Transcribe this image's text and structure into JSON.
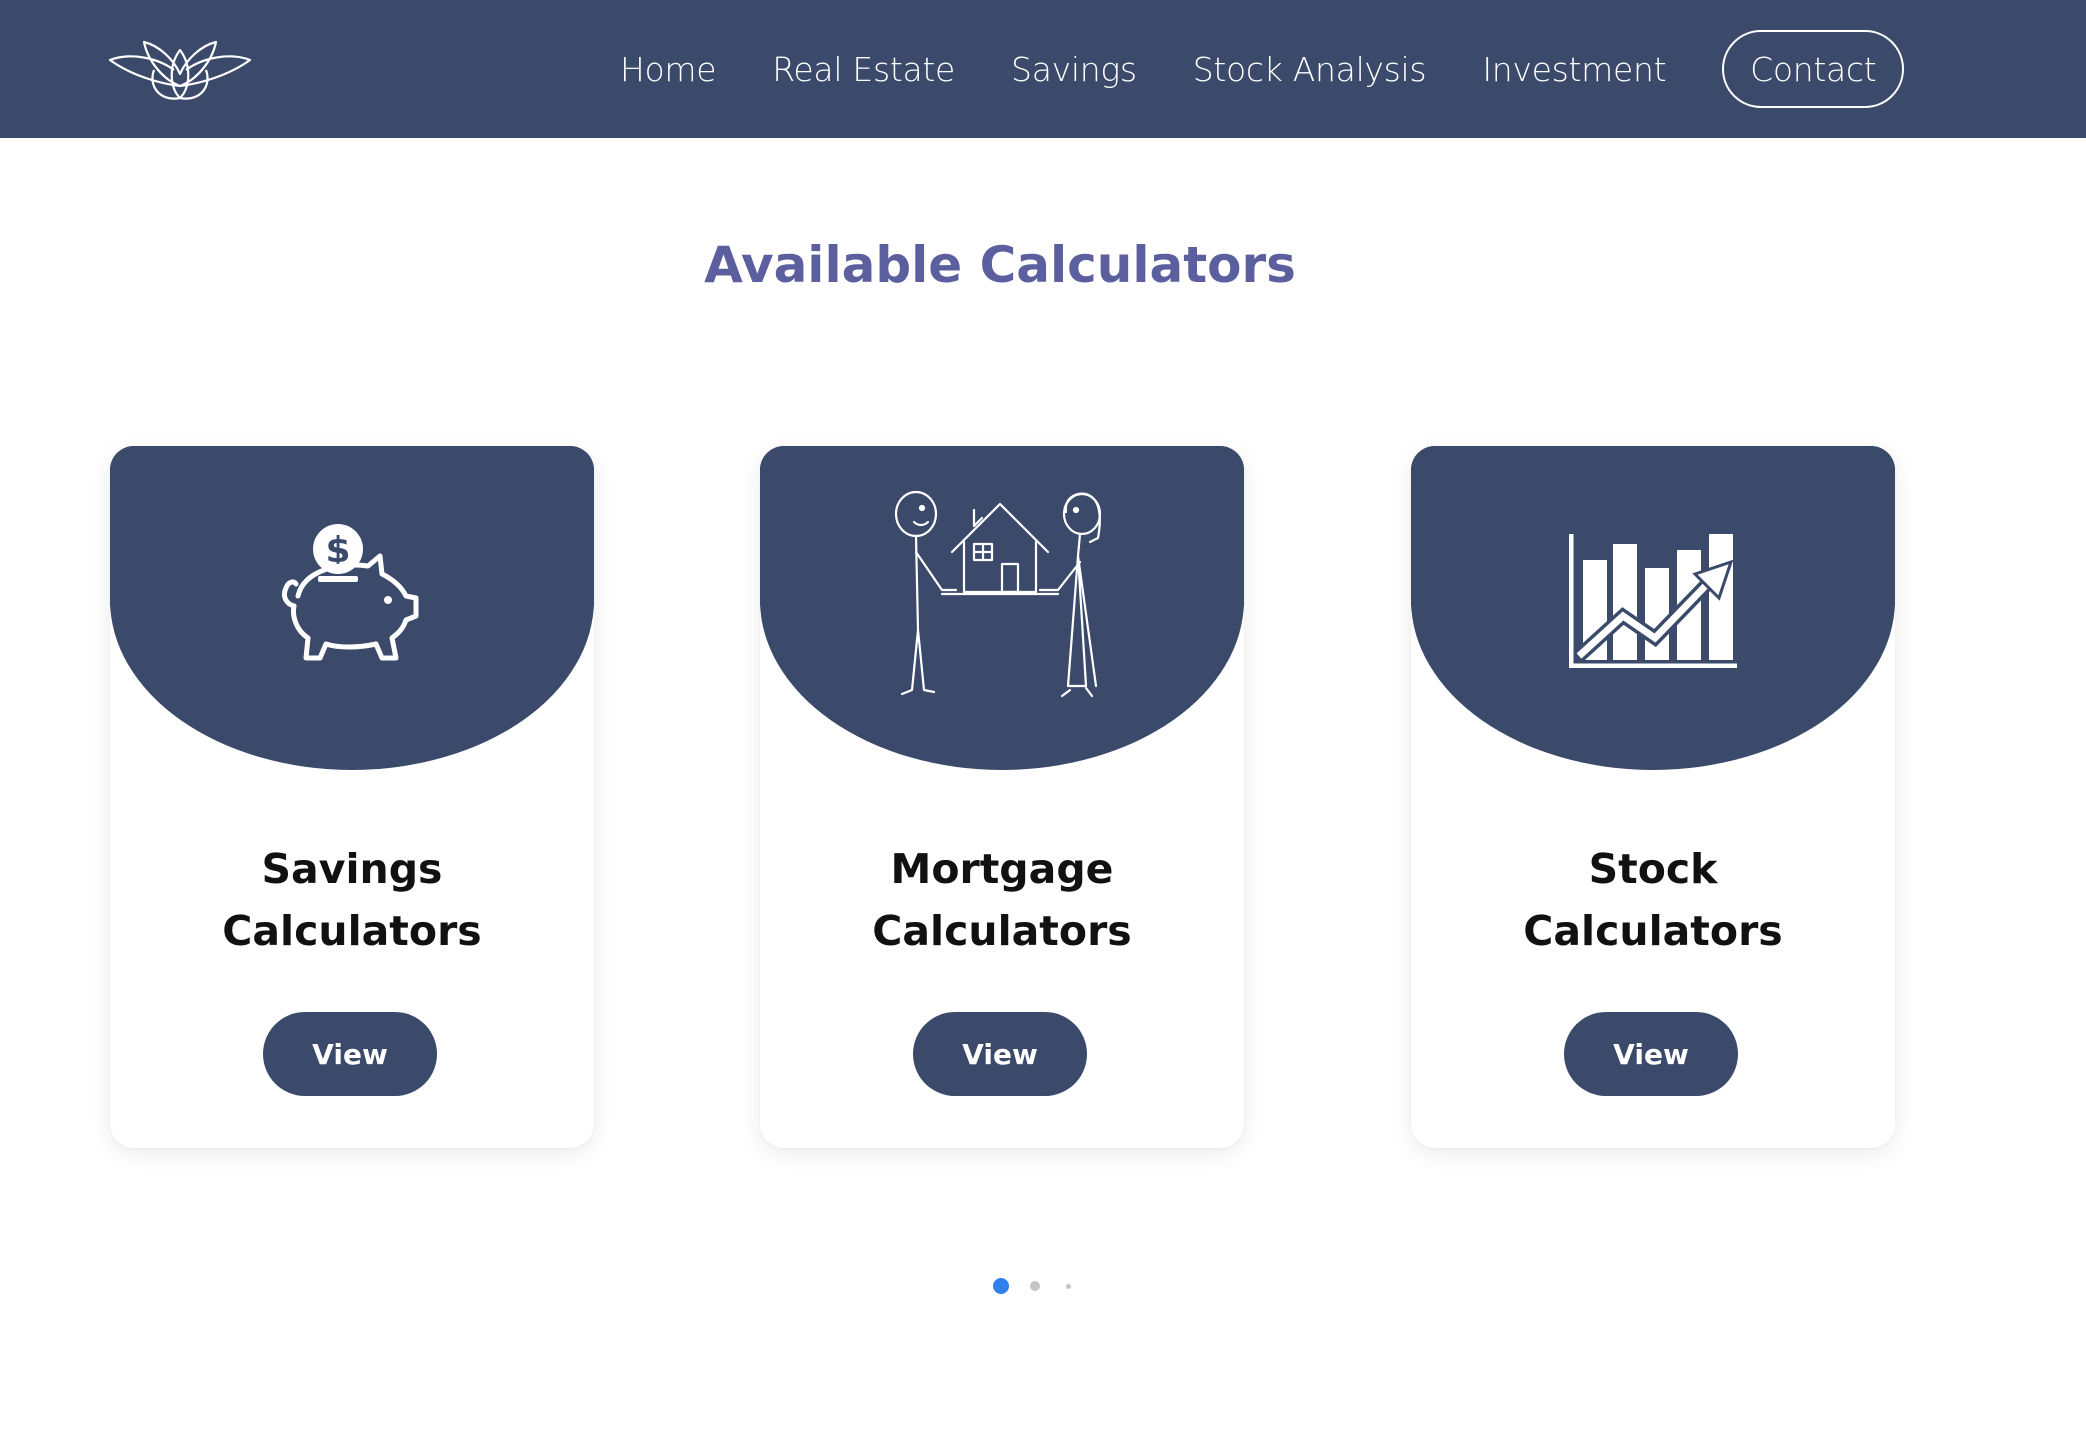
{
  "navbar": {
    "logo_icon": "lotus-leaf-logo",
    "links": [
      "Home",
      "Real Estate",
      "Savings",
      "Stock Analysis",
      "Investment"
    ],
    "contact_label": "Contact",
    "background": "#3b4a6b"
  },
  "main": {
    "title": "Available Calculators",
    "title_color": "#5b5f9e",
    "cards": [
      {
        "icon": "piggy-bank-icon",
        "title": "Savings Calculators",
        "button": "View"
      },
      {
        "icon": "couple-house-icon",
        "title": "Mortgage Calculators",
        "button": "View"
      },
      {
        "icon": "bar-chart-growth-icon",
        "title": "Stock Calculators",
        "button": "View"
      }
    ]
  },
  "carousel": {
    "pages": 3,
    "active_page": 1,
    "active_color": "#2f80ed"
  }
}
